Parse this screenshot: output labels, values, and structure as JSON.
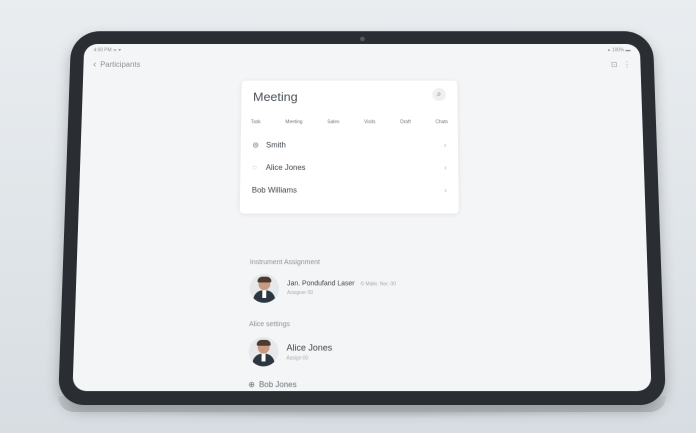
{
  "statusbar": {
    "left": "4:00 PM ᯤ ▾",
    "right": "▸ 100% ▬"
  },
  "nav": {
    "back_label": "Participants",
    "icons": [
      "share-icon",
      "more-icon"
    ]
  },
  "meeting": {
    "title": "Meeting",
    "tabs": [
      "Task",
      "Meeting",
      "Sales",
      "Visits",
      "Draft",
      "Chats"
    ],
    "rows": [
      {
        "label": "Smith",
        "icon": "at-icon"
      },
      {
        "label": "Alice Jones",
        "icon": "chat-icon"
      },
      {
        "label": "Bob Williams",
        "icon": ""
      }
    ]
  },
  "sections": {
    "first_label": "Instrument Assignment",
    "second_label": "Alice settings"
  },
  "people": [
    {
      "name": "Jan. Pondufand Laser",
      "extra": "© Malin. Nor. 00",
      "sub": "Assigner 00"
    },
    {
      "name": "Alice Jones",
      "sub": "Assign 00"
    }
  ],
  "bottom": {
    "label": "Bob Jones"
  }
}
